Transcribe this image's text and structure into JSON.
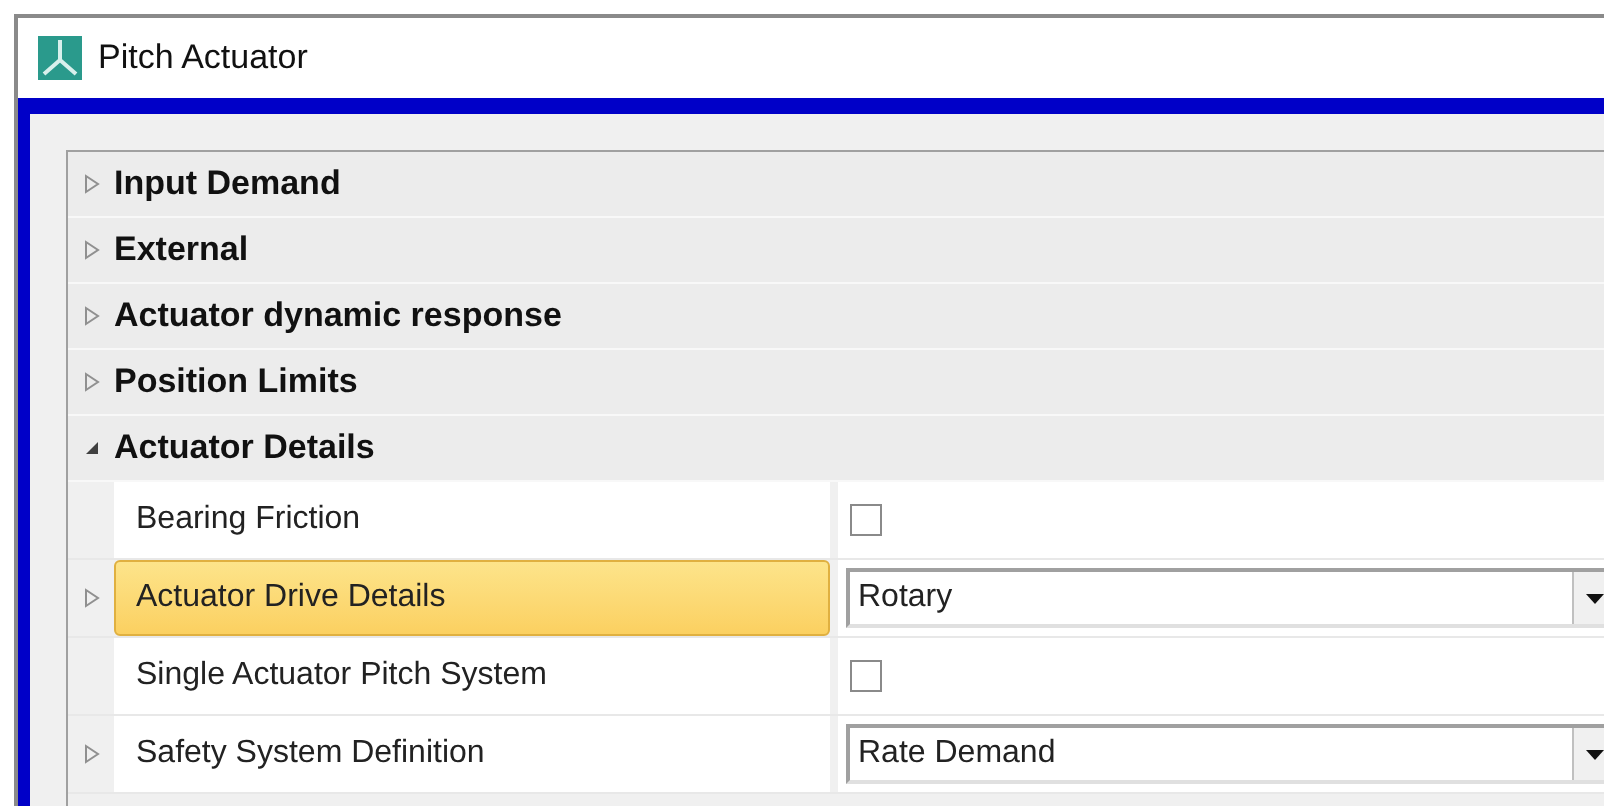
{
  "window": {
    "title": "Pitch Actuator"
  },
  "categories": [
    {
      "label": "Input Demand",
      "expanded": false
    },
    {
      "label": "External",
      "expanded": false
    },
    {
      "label": "Actuator dynamic response",
      "expanded": false
    },
    {
      "label": "Position Limits",
      "expanded": false
    },
    {
      "label": "Actuator Details",
      "expanded": true,
      "properties": [
        {
          "name": "Bearing Friction",
          "kind": "checkbox",
          "checked": false,
          "expandable": false,
          "selected": false
        },
        {
          "name": "Actuator Drive Details",
          "kind": "dropdown",
          "value": "Rotary",
          "expandable": true,
          "selected": true
        },
        {
          "name": "Single Actuator Pitch System",
          "kind": "checkbox",
          "checked": false,
          "expandable": false,
          "selected": false
        },
        {
          "name": "Safety System Definition",
          "kind": "dropdown",
          "value": "Rate Demand",
          "expandable": true,
          "selected": false
        }
      ]
    }
  ]
}
